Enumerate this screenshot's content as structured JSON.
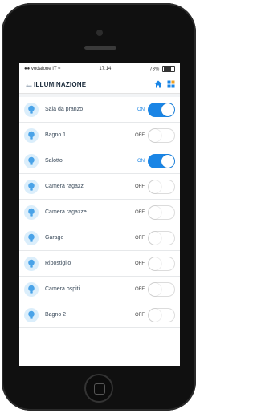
{
  "status_bar": {
    "carrier": "●● vodafone IT ≈",
    "time": "17:14",
    "battery": "73%"
  },
  "header": {
    "title": "ILLUMINAZIONE",
    "back_icon": "back-arrow-icon",
    "home_icon": "home-icon",
    "menu_icon": "grid-icon"
  },
  "colors": {
    "accent": "#1a85e5",
    "bulb_bg": "#dbeefb"
  },
  "lights": [
    {
      "name": "Sala da pranzo",
      "state": "ON"
    },
    {
      "name": "Bagno 1",
      "state": "OFF"
    },
    {
      "name": "Salotto",
      "state": "ON"
    },
    {
      "name": "Camera ragazzi",
      "state": "OFF"
    },
    {
      "name": "Camera ragazze",
      "state": "OFF"
    },
    {
      "name": "Garage",
      "state": "OFF"
    },
    {
      "name": "Ripostiglio",
      "state": "OFF"
    },
    {
      "name": "Camera ospiti",
      "state": "OFF"
    },
    {
      "name": "Bagno 2",
      "state": "OFF"
    }
  ]
}
